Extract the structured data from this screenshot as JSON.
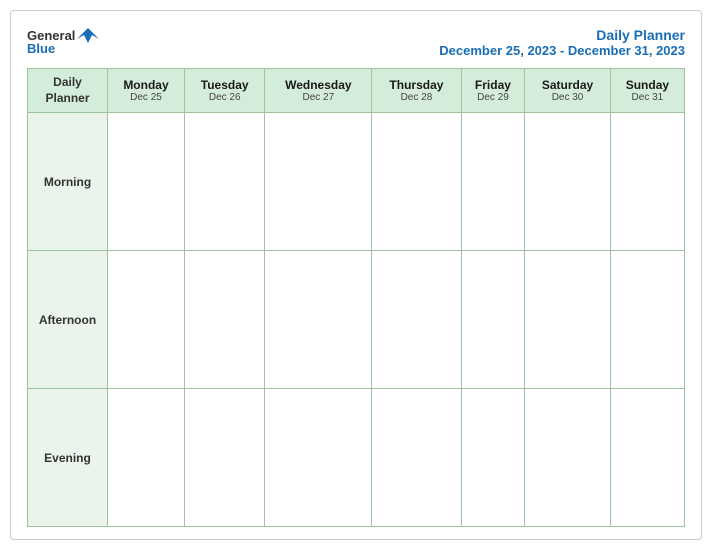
{
  "header": {
    "logo_general": "General",
    "logo_blue": "Blue",
    "title": "Daily Planner",
    "subtitle": "December 25, 2023 - December 31, 2023"
  },
  "table": {
    "header_label": "Daily Planner",
    "days": [
      {
        "name": "Monday",
        "date": "Dec 25"
      },
      {
        "name": "Tuesday",
        "date": "Dec 26"
      },
      {
        "name": "Wednesday",
        "date": "Dec 27"
      },
      {
        "name": "Thursday",
        "date": "Dec 28"
      },
      {
        "name": "Friday",
        "date": "Dec 29"
      },
      {
        "name": "Saturday",
        "date": "Dec 30"
      },
      {
        "name": "Sunday",
        "date": "Dec 31"
      }
    ],
    "rows": [
      {
        "label": "Morning"
      },
      {
        "label": "Afternoon"
      },
      {
        "label": "Evening"
      }
    ]
  }
}
